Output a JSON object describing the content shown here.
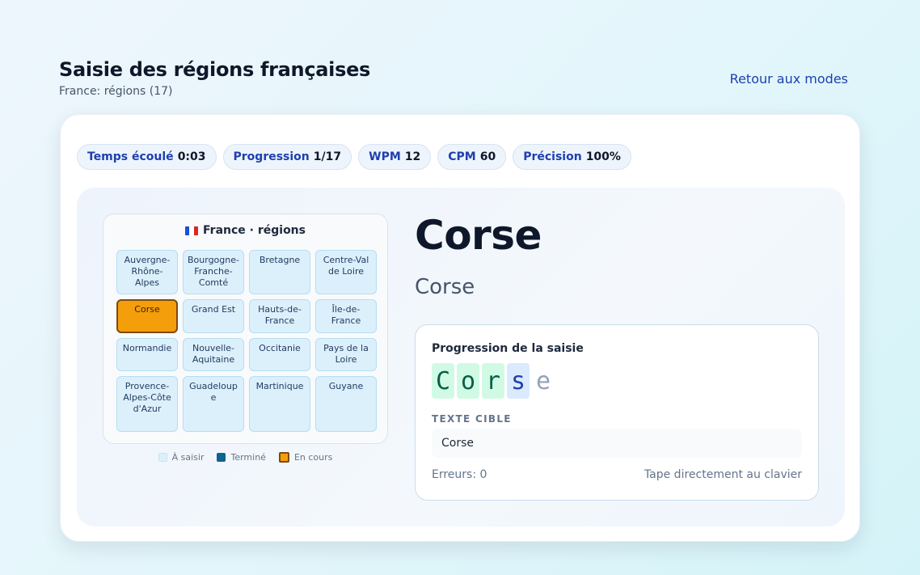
{
  "header": {
    "title": "Saisie des régions françaises",
    "subtitle": "France: régions (17)",
    "back_label": "Retour aux modes"
  },
  "stats": [
    {
      "label": "Temps écoulé",
      "value": "0:03"
    },
    {
      "label": "Progression",
      "value": "1/17"
    },
    {
      "label": "WPM",
      "value": "12"
    },
    {
      "label": "CPM",
      "value": "60"
    },
    {
      "label": "Précision",
      "value": "100%"
    }
  ],
  "map": {
    "flag_icon": "flag-france-icon",
    "title": "France · régions",
    "regions": [
      {
        "name": "Auvergne-Rhône-Alpes",
        "state": "todo"
      },
      {
        "name": "Bourgogne-Franche-Comté",
        "state": "todo"
      },
      {
        "name": "Bretagne",
        "state": "todo"
      },
      {
        "name": "Centre-Val de Loire",
        "state": "todo"
      },
      {
        "name": "Corse",
        "state": "current"
      },
      {
        "name": "Grand Est",
        "state": "todo"
      },
      {
        "name": "Hauts-de-France",
        "state": "todo"
      },
      {
        "name": "Île-de-France",
        "state": "todo"
      },
      {
        "name": "Normandie",
        "state": "todo"
      },
      {
        "name": "Nouvelle-Aquitaine",
        "state": "todo"
      },
      {
        "name": "Occitanie",
        "state": "todo"
      },
      {
        "name": "Pays de la Loire",
        "state": "todo"
      },
      {
        "name": "Provence-Alpes-Côte d'Azur",
        "state": "todo"
      },
      {
        "name": "Guadeloupe",
        "state": "todo"
      },
      {
        "name": "Martinique",
        "state": "todo"
      },
      {
        "name": "Guyane",
        "state": "todo"
      }
    ],
    "legend": {
      "todo": "À saisir",
      "done": "Terminé",
      "current": "En cours"
    }
  },
  "current": {
    "name": "Corse",
    "subtitle": "Corse"
  },
  "typing": {
    "title": "Progression de la saisie",
    "chars": [
      {
        "c": "C",
        "state": "ok"
      },
      {
        "c": "o",
        "state": "ok"
      },
      {
        "c": "r",
        "state": "ok"
      },
      {
        "c": "s",
        "state": "cur"
      },
      {
        "c": "e",
        "state": "pending"
      }
    ],
    "target_label": "TEXTE CIBLE",
    "target_text": "Corse",
    "errors": "Erreurs: 0",
    "hint": "Tape directement au clavier"
  },
  "colors": {
    "accent": "#1e40af",
    "current_region": "#f59e0b",
    "done_region": "#0e6391",
    "todo_region": "#dcf0fb"
  }
}
